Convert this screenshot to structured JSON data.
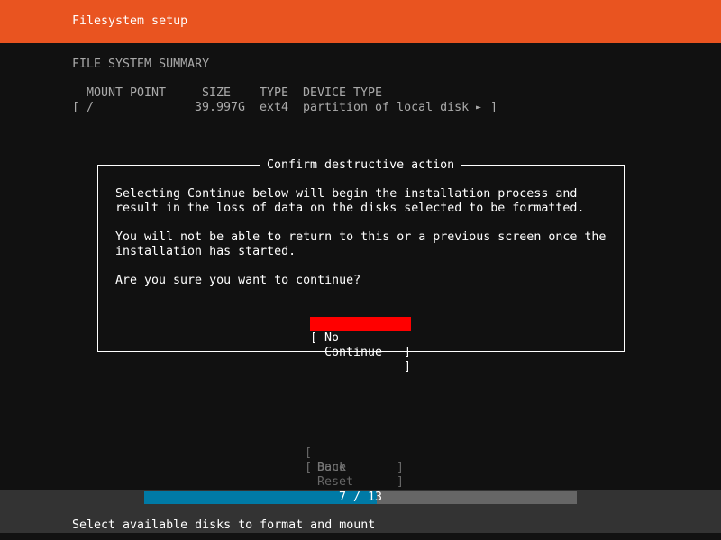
{
  "header": {
    "title": "Filesystem setup",
    "color": "#e95420"
  },
  "summary": {
    "heading": "FILE SYSTEM SUMMARY",
    "columns": [
      "MOUNT POINT",
      "SIZE",
      "TYPE",
      "DEVICE TYPE"
    ],
    "rows": [
      {
        "mount": "/",
        "size": "39.997G",
        "type": "ext4",
        "device_type": "partition of local disk",
        "arrow": "►"
      }
    ]
  },
  "dialog": {
    "title": "Confirm destructive action",
    "lines": [
      "Selecting Continue below will begin the installation process and",
      "result in the loss of data on the disks selected to be formatted.",
      "You will not be able to return to this or a previous screen once the",
      "installation has started.",
      "Are you sure you want to continue?"
    ],
    "buttons": {
      "no": "No",
      "continue": "Continue"
    },
    "focus_color": "#ff0000"
  },
  "actions": {
    "done": "Done",
    "reset": "Reset",
    "back": "Back"
  },
  "progress": {
    "current": 7,
    "total": 13,
    "label": "7 / 13",
    "fill_color": "#007aa6"
  },
  "footer": {
    "help": "Select available disks to format and mount"
  }
}
